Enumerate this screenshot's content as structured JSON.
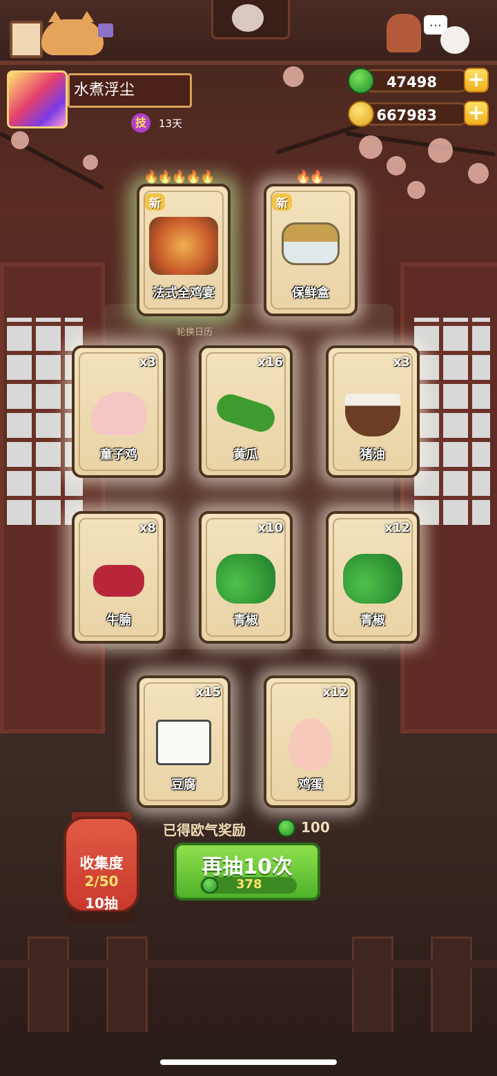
{
  "player": {
    "name": "水煮浮尘",
    "skill_badge": "技",
    "days": "13天"
  },
  "currency": {
    "gems": "47498",
    "coins": "667983",
    "plus_label": "+"
  },
  "calendar_label": "轮换日历",
  "special_cards": [
    {
      "name": "法式全鸡宴",
      "tag": "新",
      "flames": "🔥🔥🔥🔥🔥"
    },
    {
      "name": "保鲜盒",
      "tag": "新",
      "flames": "🔥🔥"
    }
  ],
  "cards": [
    {
      "name": "童子鸡",
      "qty": "x3"
    },
    {
      "name": "黄瓜",
      "qty": "x16"
    },
    {
      "name": "猪油",
      "qty": "x3"
    },
    {
      "name": "牛腩",
      "qty": "x8"
    },
    {
      "name": "青椒",
      "qty": "x10"
    },
    {
      "name": "青椒",
      "qty": "x12"
    },
    {
      "name": "豆腐",
      "qty": "x15"
    },
    {
      "name": "鸡蛋",
      "qty": "x12"
    }
  ],
  "reward": {
    "label": "已得欧气奖励",
    "value": "100"
  },
  "draw_button": {
    "label": "再抽10次",
    "cost": "378"
  },
  "collection": {
    "title": "收集度",
    "progress": "2/50",
    "draws": "10抽"
  },
  "colors": {
    "background": "#4a2520",
    "accent_green": "#4fb22a",
    "card_bg": "#f3e2bd",
    "gold": "#f2b01d"
  }
}
